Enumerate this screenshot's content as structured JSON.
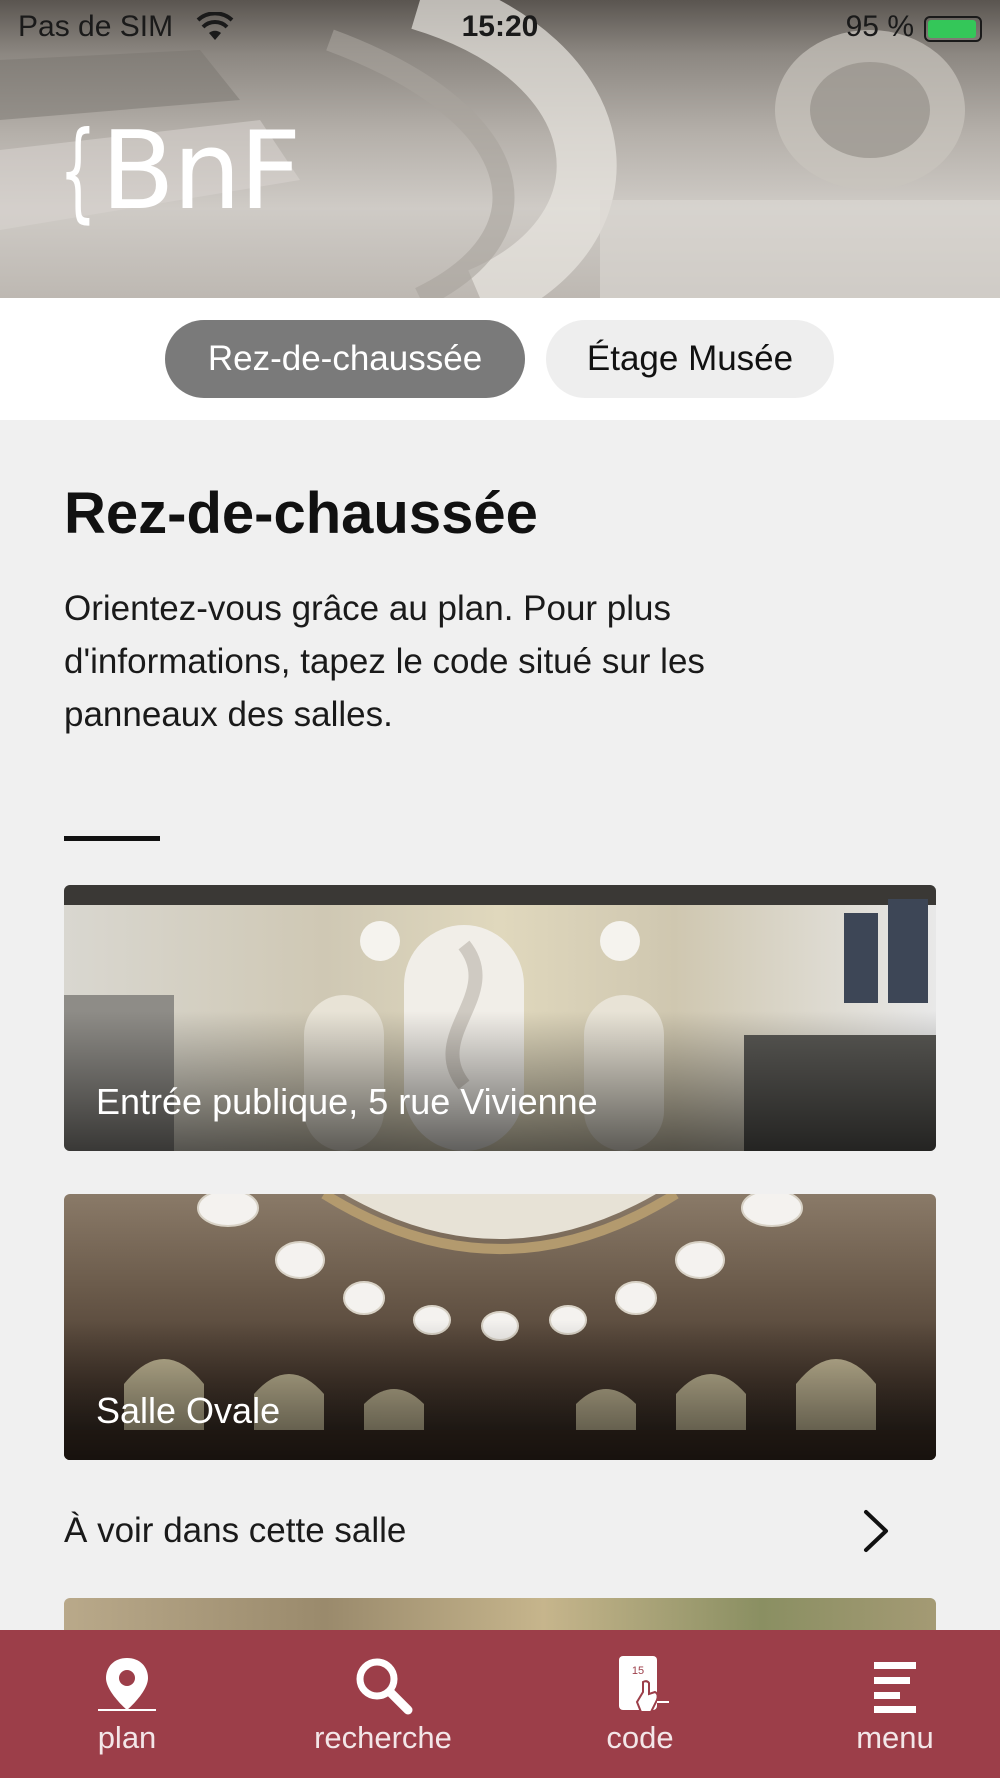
{
  "status_bar": {
    "carrier": "Pas de SIM",
    "time": "15:20",
    "battery": "95 %",
    "battery_level": 0.95
  },
  "header": {
    "logo_text": "BnF"
  },
  "floor_tabs": {
    "active": "Rez-de-chaussée",
    "inactive": "Étage Musée"
  },
  "main": {
    "title": "Rez-de-chaussée",
    "intro": "Orientez-vous grâce au plan. Pour plus d'informations, tapez le code situé sur les panneaux des salles.",
    "cards": [
      {
        "label": "Entrée publique, 5 rue Vivienne"
      },
      {
        "label": "Salle Ovale"
      }
    ],
    "see_in_room": "À voir dans cette salle"
  },
  "bottom_nav": {
    "items": [
      {
        "label": "plan",
        "icon": "map-pin-icon"
      },
      {
        "label": "recherche",
        "icon": "search-icon"
      },
      {
        "label": "code",
        "icon": "code-tablet-icon"
      },
      {
        "label": "menu",
        "icon": "menu-icon"
      }
    ]
  },
  "colors": {
    "brand": "#9c3e49",
    "active_tab": "#7a7a7a",
    "background": "#f0f0f0"
  }
}
